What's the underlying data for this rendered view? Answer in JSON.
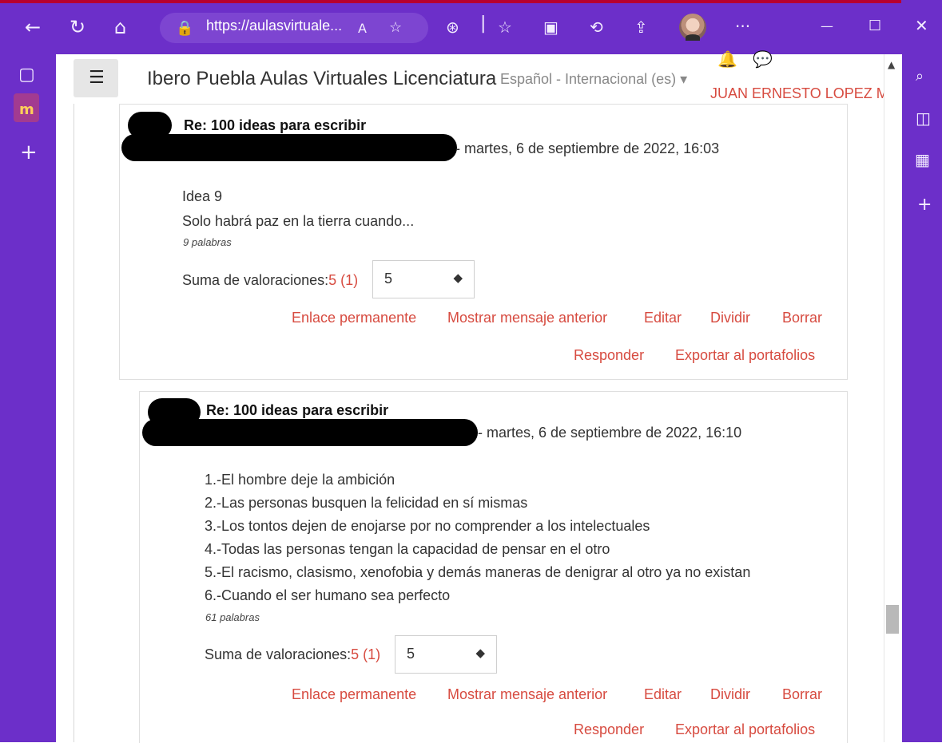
{
  "browser": {
    "url_text": "https://aulasvirtuale...",
    "more_label": "···",
    "window_minimize": "—",
    "window_maximize": "☐",
    "window_close": "✕"
  },
  "header": {
    "menu_icon": "☰",
    "site_name": "Ibero Puebla Aulas Virtuales Licenciatura",
    "language": "Español - Internacional (es) ▾",
    "user_name": "JUAN ERNESTO LOPEZ MA"
  },
  "posts": [
    {
      "subject": "Re: 100 ideas para escribir",
      "date": "- martes, 6 de septiembre de 2022, 16:03",
      "lines": [
        "Idea 9",
        "Solo habrá paz en la tierra cuando..."
      ],
      "word_count": "9 palabras",
      "rating_label": "Suma de valoraciones:",
      "rating_value": "5 (1)",
      "rating_selected": "5",
      "actions": [
        "Enlace permanente",
        "Mostrar mensaje anterior",
        "Editar",
        "Dividir",
        "Borrar",
        "Responder",
        "Exportar al portafolios"
      ]
    },
    {
      "subject": "Re: 100 ideas para escribir",
      "date": "- martes, 6 de septiembre de 2022, 16:10",
      "lines": [
        "1.-El hombre deje la ambición",
        "2.-Las personas busquen la felicidad en sí mismas",
        "3.-Los tontos dejen de enojarse por no comprender a los intelectuales",
        "4.-Todas las personas tengan la capacidad de pensar en el otro",
        "5.-El racismo, clasismo, xenofobia y demás maneras de denigrar al otro ya no existan",
        "6.-Cuando el ser humano sea perfecto"
      ],
      "word_count": "61 palabras",
      "rating_label": "Suma de valoraciones:",
      "rating_value": "5 (1)",
      "rating_selected": "5",
      "actions": [
        "Enlace permanente",
        "Mostrar mensaje anterior",
        "Editar",
        "Dividir",
        "Borrar",
        "Responder",
        "Exportar al portafolios"
      ]
    }
  ]
}
